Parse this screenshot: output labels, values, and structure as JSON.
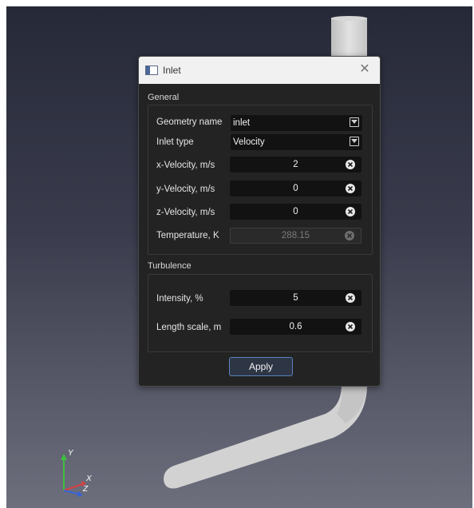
{
  "dialog": {
    "title": "Inlet",
    "close_glyph": "✕",
    "title_icon": "window-icon"
  },
  "general": {
    "section_label": "General",
    "geometry_name": {
      "label": "Geometry name",
      "value": "inlet"
    },
    "inlet_type": {
      "label": "Inlet type",
      "value": "Velocity"
    },
    "x_velocity": {
      "label": "x-Velocity, m/s",
      "value": "2"
    },
    "y_velocity": {
      "label": "y-Velocity, m/s",
      "value": "0"
    },
    "z_velocity": {
      "label": "z-Velocity, m/s",
      "value": "0"
    },
    "temperature": {
      "label": "Temperature, K",
      "value": "288.15",
      "enabled": false
    }
  },
  "turbulence": {
    "section_label": "Turbulence",
    "intensity": {
      "label": "Intensity, %",
      "value": "5"
    },
    "length_scale": {
      "label": "Length scale, m",
      "value": "0.6"
    }
  },
  "actions": {
    "apply_label": "Apply"
  },
  "axes": {
    "y": "Y",
    "x": "X",
    "z": "Z"
  },
  "colors": {
    "dialog_bg": "#232323",
    "field_bg": "#121212",
    "accent_border": "#5b82bd",
    "pipe": "#d4d4d4"
  }
}
